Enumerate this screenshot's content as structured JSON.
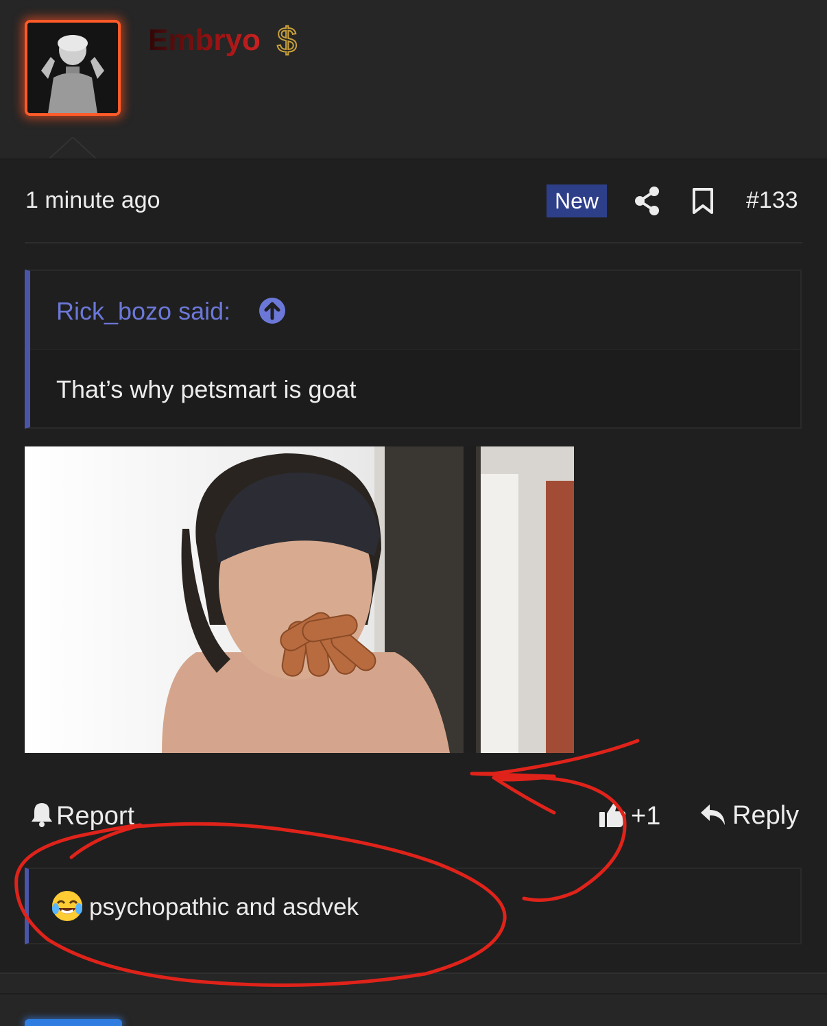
{
  "user": {
    "name": "Embryo",
    "badge_icon": "dollar-icon"
  },
  "meta": {
    "timestamp": "1 minute ago",
    "new_label": "New",
    "post_number": "#133"
  },
  "quote": {
    "author": "Rick_bozo said:",
    "text": "That’s why petsmart is goat"
  },
  "actions": {
    "report": "Report",
    "like_count": "+1",
    "reply": "Reply"
  },
  "reaction": {
    "emoji": "😂",
    "text": "psychopathic and asdvek"
  },
  "colors": {
    "accent": "#4b55a8",
    "badge": "#2e3f8a",
    "avatar_border": "#ff5a28",
    "annotation": "#e0231a"
  }
}
